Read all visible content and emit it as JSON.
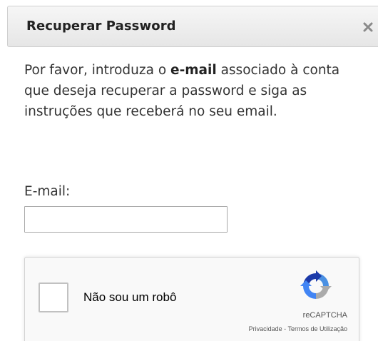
{
  "dialog": {
    "title": "Recuperar Password",
    "close_icon": "close-icon"
  },
  "instructions": {
    "part1": "Por favor, introduza o ",
    "emphasis": "e-mail",
    "part2": " associado à conta que deseja recuperar a password e siga as instruções que receberá no seu email."
  },
  "form": {
    "email_label": "E-mail:",
    "email_value": "",
    "email_placeholder": ""
  },
  "recaptcha": {
    "checkbox_label": "Não sou um robô",
    "brand": "reCAPTCHA",
    "privacy_link": "Privacidade",
    "separator": " - ",
    "terms_link": "Termos de Utilização",
    "logo_icon": "recaptcha-logo-icon"
  }
}
